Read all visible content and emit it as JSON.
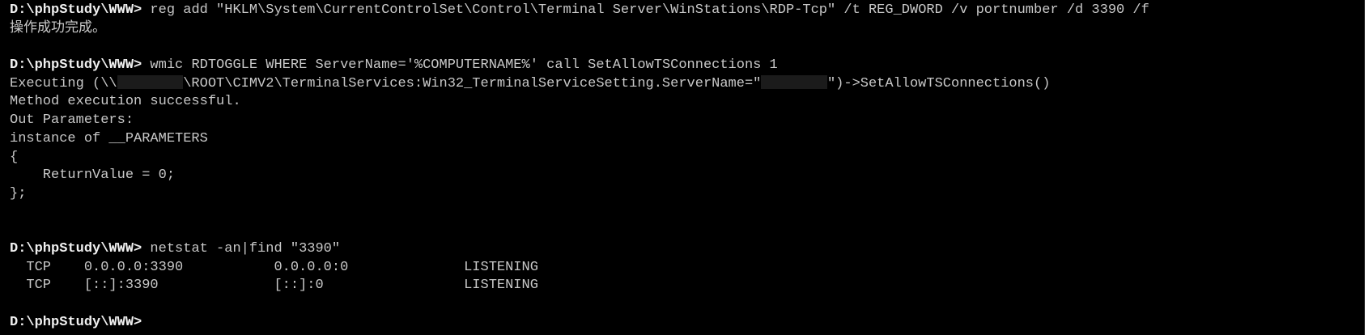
{
  "terminal": {
    "prompt": "D:\\phpStudy\\WWW>",
    "cmd_reg": " reg add \"HKLM\\System\\CurrentControlSet\\Control\\Terminal Server\\WinStations\\RDP-Tcp\" /t REG_DWORD /v portnumber /d 3390 /f",
    "out_reg": "操作成功完成。",
    "cmd_wmic": " wmic RDTOGGLE WHERE ServerName='%COMPUTERNAME%' call SetAllowTSConnections 1",
    "exec_prefix": "Executing (\\\\",
    "exec_middle": "\\ROOT\\CIMV2\\TerminalServices:Win32_TerminalServiceSetting.ServerName=\"",
    "exec_suffix": "\")->SetAllowTSConnections()",
    "method_success": "Method execution successful.",
    "out_params": "Out Parameters:",
    "instance_of": "instance of __PARAMETERS",
    "brace_open": "{",
    "return_value": "    ReturnValue = 0;",
    "brace_close": "};",
    "cmd_netstat": " netstat -an|find \"3390\"",
    "netstat_row1": "  TCP    0.0.0.0:3390           0.0.0.0:0              LISTENING",
    "netstat_row2": "  TCP    [::]:3390              [::]:0                 LISTENING"
  }
}
